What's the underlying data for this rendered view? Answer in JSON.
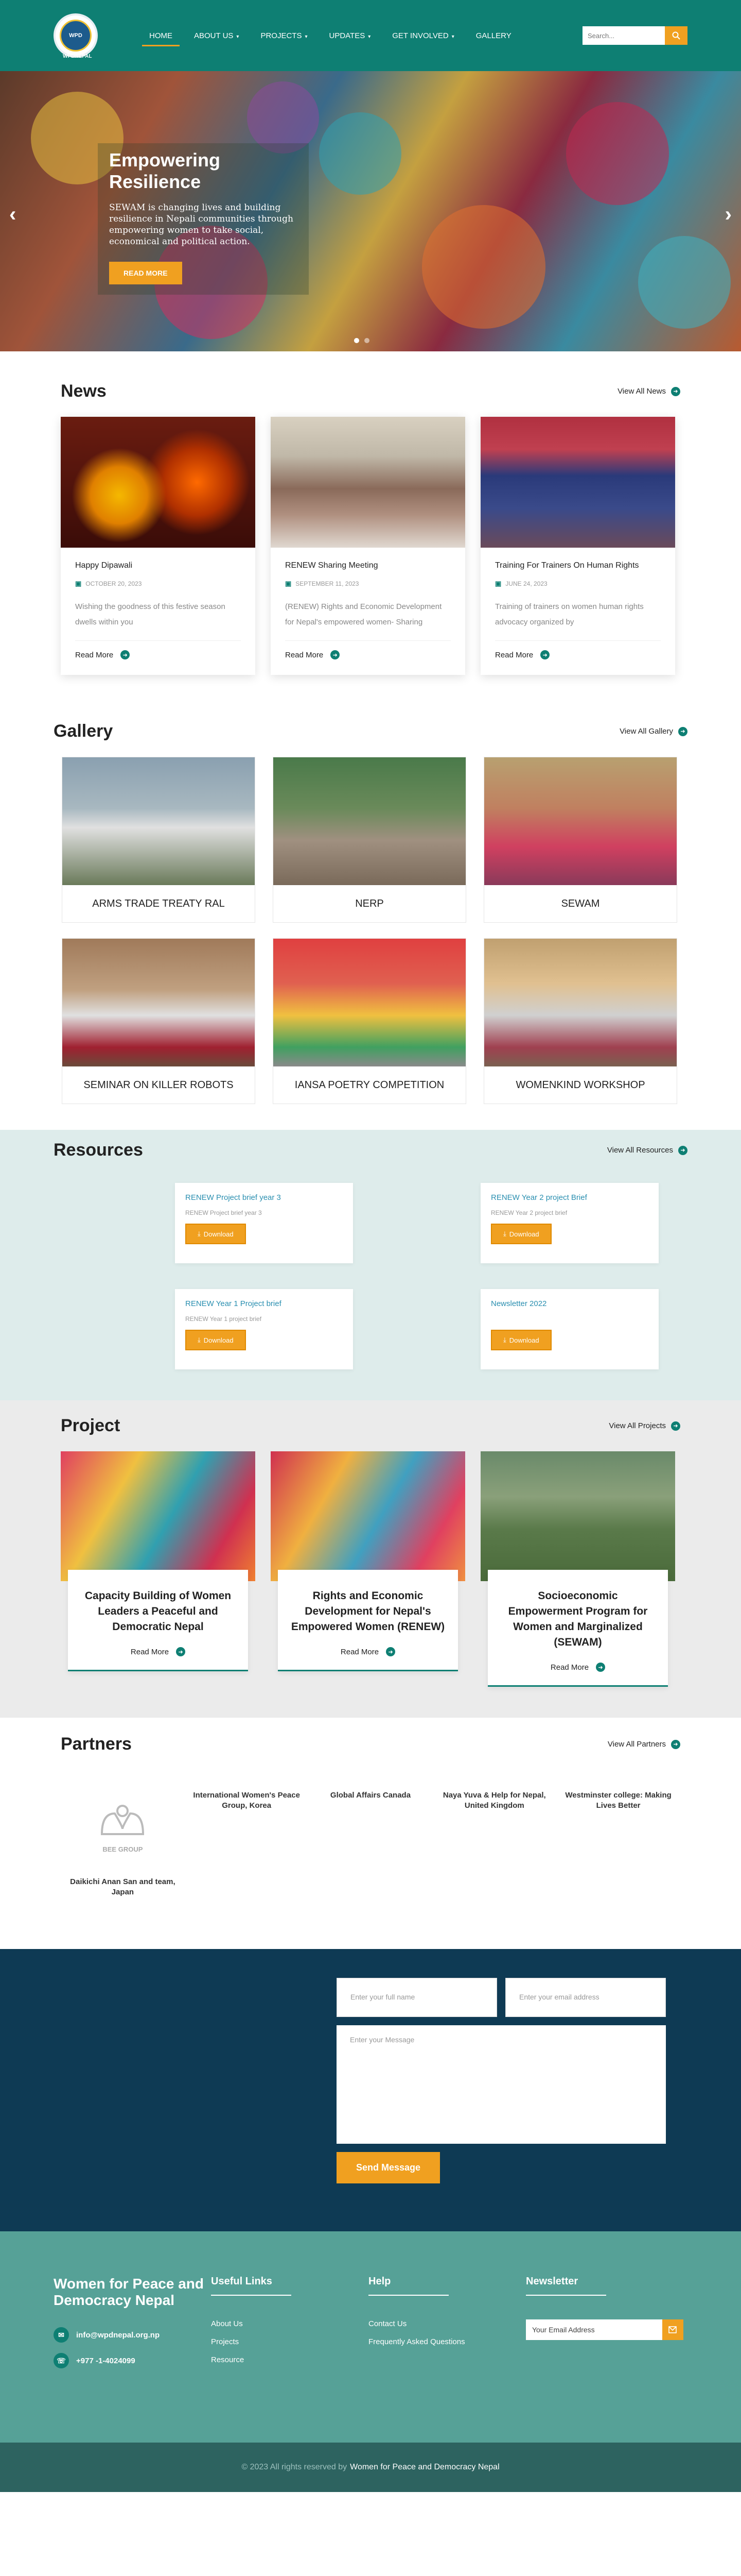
{
  "header": {
    "logo_text": "WPD",
    "logo_caption": "WPDNEPAL",
    "nav": [
      {
        "label": "HOME",
        "dropdown": false,
        "active": true
      },
      {
        "label": "ABOUT US",
        "dropdown": true
      },
      {
        "label": "PROJECTS",
        "dropdown": true
      },
      {
        "label": "UPDATES",
        "dropdown": true
      },
      {
        "label": "GET INVOLVED",
        "dropdown": true
      },
      {
        "label": "GALLERY",
        "dropdown": false
      }
    ],
    "search_placeholder": "Search..."
  },
  "hero": {
    "title": "Empowering Resilience",
    "text": "SEWAM is changing lives and building resilience in Nepali communities through empowering women to take social, economical and political action.",
    "button": "READ MORE"
  },
  "news": {
    "title": "News",
    "view_all": "View All News",
    "items": [
      {
        "title": "Happy Dipawali",
        "date": "OCTOBER 20, 2023",
        "text": "Wishing the goodness of this festive season dwells within you",
        "more": "Read More"
      },
      {
        "title": "RENEW Sharing Meeting",
        "date": "SEPTEMBER 11, 2023",
        "text": "(RENEW) Rights and Economic Development for Nepal's empowered women- Sharing",
        "more": "Read More"
      },
      {
        "title": "Training For Trainers On Human Rights",
        "date": "JUNE 24, 2023",
        "text": "Training of trainers on women human rights advocacy organized by",
        "more": "Read More"
      }
    ]
  },
  "gallery": {
    "title": "Gallery",
    "view_all": "View All Gallery",
    "items": [
      {
        "label": "ARMS TRADE TREATY RAL"
      },
      {
        "label": "NERP"
      },
      {
        "label": "SEWAM"
      },
      {
        "label": "SEMINAR ON KILLER ROBOTS"
      },
      {
        "label": "IANSA POETRY COMPETITION"
      },
      {
        "label": "WOMENKIND WORKSHOP"
      }
    ]
  },
  "resources": {
    "title": "Resources",
    "view_all": "View All Resources",
    "download_label": "Download",
    "items": [
      {
        "title": "RENEW Project brief year 3",
        "sub": "RENEW Project brief year 3"
      },
      {
        "title": "RENEW Year 2 project Brief",
        "sub": "RENEW Year 2 project brief"
      },
      {
        "title": "RENEW Year 1 Project brief",
        "sub": "RENEW Year 1 project brief"
      },
      {
        "title": "Newsletter 2022",
        "sub": ""
      }
    ]
  },
  "projects": {
    "title": "Project",
    "view_all": "View All Projects",
    "items": [
      {
        "title": "Capacity Building of Women Leaders a Peaceful and Democratic Nepal",
        "more": "Read More"
      },
      {
        "title": "Rights and Economic Development for Nepal's Empowered Women (RENEW)",
        "more": "Read More"
      },
      {
        "title": "Socioeconomic Empowerment Program for Women and Marginalized (SEWAM)",
        "more": "Read More"
      }
    ]
  },
  "partners": {
    "title": "Partners",
    "view_all": "View All Partners",
    "logo_text": "BEE GROUP",
    "items": [
      {
        "name": "Daikichi Anan San and team, Japan"
      },
      {
        "name": "International Women's Peace Group, Korea"
      },
      {
        "name": "Global Affairs Canada"
      },
      {
        "name": "Naya Yuva & Help for Nepal, United Kingdom"
      },
      {
        "name": "Westminster college: Making Lives Better"
      }
    ]
  },
  "contact": {
    "name_placeholder": "Enter your full name",
    "email_placeholder": "Enter your email address",
    "message_placeholder": "Enter your Message",
    "send": "Send Message"
  },
  "footer": {
    "brand": "Women for Peace and Democracy Nepal",
    "email": "info@wpdnepal.org.np",
    "phone": "+977 -1-4024099",
    "useful_title": "Useful Links",
    "useful": [
      "About Us",
      "Projects",
      "Resource"
    ],
    "help_title": "Help",
    "help": [
      "Contact Us",
      "Frequently Asked Questions"
    ],
    "newsletter_title": "Newsletter",
    "newsletter_placeholder": "Your Email Address",
    "copyright": "© 2023 All rights reserved by",
    "copyright_org": "Women for Peace and Democracy Nepal"
  },
  "colors": {
    "primary": "#0e7f73",
    "accent": "#f0a020",
    "dark": "#0e3a54",
    "footer": "#56a197"
  }
}
